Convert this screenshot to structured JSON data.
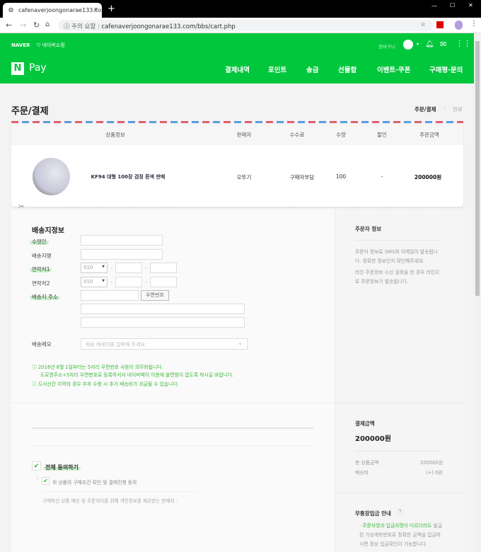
{
  "browser": {
    "tab_title": "cafenaverjoongonarae133.com/",
    "new_tab": "+",
    "security_label": "주의 요함",
    "url": "cafenaverjoongonarae133.com/bbs/cart.php"
  },
  "header": {
    "naver": "NAVER",
    "shopping": "네이버쇼핑",
    "cart": "장바구니",
    "pay_logo_n": "N",
    "pay_logo": "Pay",
    "nav": [
      "결제내역",
      "포인트",
      "송금",
      "선물함",
      "이벤트·쿠폰",
      "구매평·문의"
    ],
    "brand_color": "#00c73c"
  },
  "page": {
    "title": "주문/결제",
    "steps": [
      "주문/결제",
      "완료"
    ]
  },
  "table": {
    "headers": [
      "상품정보",
      "판매자",
      "수수료",
      "수량",
      "할인",
      "주문금액"
    ],
    "row": {
      "name": "KF94 대형 100장 검정 흰색 판매",
      "seller": "오뚜기",
      "fee": "구매자부담",
      "qty": "100",
      "discount": "-",
      "amount": "200000원"
    }
  },
  "shipping": {
    "title": "배송지정보",
    "labels": {
      "recipient": "수령인",
      "place": "배송지명",
      "phone1": "연락처1",
      "phone2": "연락처2",
      "address": "배송지 주소",
      "memo": "배송메모"
    },
    "phone_prefix": "010",
    "zip_button": "우편번호",
    "memo_placeholder": "배송 메세지를 입력해 주세요.",
    "notes": [
      "2016년 8월 1일부터는 5자리 우편번호 사용이 의무화됩니다.",
      "도로명주소+5자리 우편번호로 등록하셔서 네이버페이 이용에 불편함이 없도록 하시길 바랍니다.",
      "도서산간 지역의 경우 추후 수령 시 추가 배송비가 과금될 수 있습니다."
    ]
  },
  "agree": {
    "all": "전체 동의하기",
    "item": "위 상품의 구매조건 확인 및 결제진행 동의",
    "privacy": "구매하신 상품 배송 및 주문처리를 위해 개인정보를 제공받는 판매자 :"
  },
  "side": {
    "orderer_title": "주문자 정보",
    "orderer_text1": "주문자 정보로 SMS와 이메일이 발송됩니다. 정확한 정보인지 확인해주세요.",
    "orderer_text2": "라인 주문정보 수신 설정을 한 경우 라인으로 주문정보가 발송됩니다.",
    "pay_title": "결제금액",
    "pay_total": "200000원",
    "items_label": "총 상품금액",
    "items_value": "200000원",
    "ship_label": "배송비",
    "ship_value": "(+) 0원",
    "bank_title": "무통장입금 안내",
    "bank_help": "?",
    "bank_highlight": "주문자명과 입금자명이 다르더라도",
    "bank_text": "발급된 가상계좌번호로 정확한 금액을 입금하시면 정상 입금확인이 가능합니다."
  }
}
